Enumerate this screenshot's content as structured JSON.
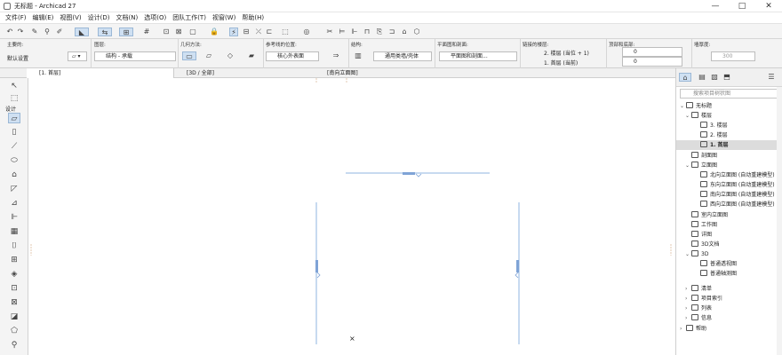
{
  "window": {
    "title": "无标题 - Archicad 27",
    "controls": [
      "—",
      "□",
      "✕"
    ]
  },
  "menu": [
    "文件(F)",
    "编辑(E)",
    "视图(V)",
    "设计(D)",
    "文档(N)",
    "选项(O)",
    "团队工作(T)",
    "视窗(W)",
    "帮助(H)"
  ],
  "infobox": {
    "main_label": "主要的:",
    "default_setting": "默认设置",
    "layer_label": "图层:",
    "layer_value": "结构 - 承载",
    "geometry_label": "几何方法:",
    "refline_label": "参考线的位置:",
    "refline_value": "核心外表面",
    "structure_label": "结构:",
    "structure_value": "通用类墙/壳体",
    "floorplan_label": "平面图和剖面:",
    "floorplan_value": "平面图和剖面...",
    "story_label": "链接的楼层:",
    "story_top": "2. 楼层 (当位 + 1)",
    "story_bottom": "1. 首层 (当前)",
    "topbottom_label": "顶部和底部:",
    "top_value": "0",
    "bottom_value": "0",
    "thickness_label": "墙厚度:",
    "thickness_value": "300"
  },
  "tabs": [
    "[1. 首层]",
    "[3D / 全部]",
    "[南向立面图]"
  ],
  "toolbox": {
    "header": "设计"
  },
  "navigator": {
    "search_placeholder": "搜索项目树状图",
    "items": [
      "无标题",
      "楼层",
      "3. 楼层",
      "2. 楼层",
      "1. 首层",
      "剖面图",
      "立面图",
      "北向立面图 (自动重建模型)",
      "东向立面图 (自动重建模型)",
      "南向立面图 (自动重建模型)",
      "西向立面图 (自动重建模型)",
      "室内立面图",
      "工作图",
      "详图",
      "3D文档",
      "3D",
      "普通透视图",
      "普通轴测图",
      "清单",
      "项目索引",
      "列表",
      "信息",
      "帮助"
    ]
  },
  "canvas": {
    "origin_marker": "×"
  }
}
